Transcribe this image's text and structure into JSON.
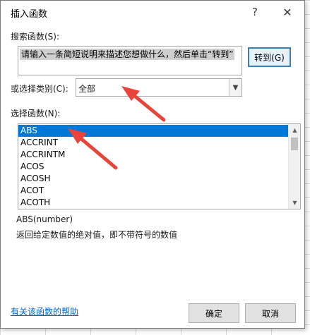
{
  "dialog": {
    "title": "插入函数",
    "help_glyph": "?",
    "close_glyph": "✕"
  },
  "search": {
    "label": "搜索函数(S):",
    "value": "请输入一条简短说明来描述您想做什么，然后单击“转到”",
    "go_label": "转到(G)"
  },
  "category": {
    "label": "或选择类别(C):",
    "selected": "全部"
  },
  "functions": {
    "label": "选择函数(N):",
    "items": [
      "ABS",
      "ACCRINT",
      "ACCRINTM",
      "ACOS",
      "ACOSH",
      "ACOT",
      "ACOTH"
    ],
    "selected_index": 0
  },
  "description": {
    "signature": "ABS(number)",
    "text": "返回给定数值的绝对值，即不带符号的数值"
  },
  "footer": {
    "help_link": "有关该函数的帮助",
    "ok_label": "确定",
    "cancel_label": "取消"
  },
  "colors": {
    "selection": "#0078d7",
    "annotation_arrow": "#e8443a",
    "link": "#0066cc"
  }
}
